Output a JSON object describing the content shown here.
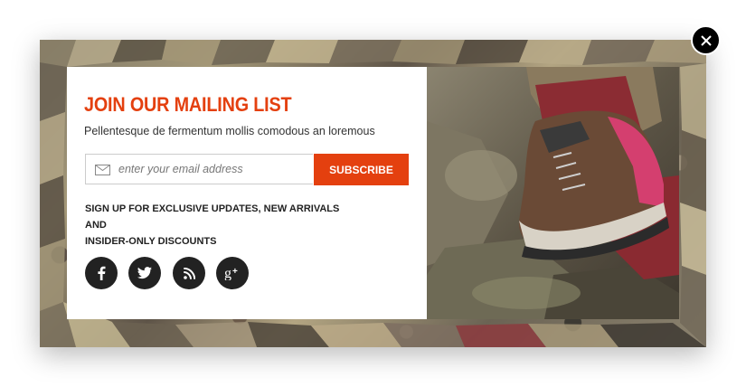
{
  "popup": {
    "title": "JOIN OUR MAILING LIST",
    "subtitle": "Pellentesque de fermentum mollis comodous an loremous",
    "email_placeholder": "enter your email address",
    "subscribe_label": "SUBSCRIBE",
    "note_line1": "SIGN UP FOR EXCLUSIVE UPDATES, NEW ARRIVALS AND",
    "note_line2": "INSIDER-ONLY DISCOUNTS",
    "close_icon": "close-icon",
    "accent_color": "#e4400f"
  },
  "social": [
    {
      "icon": "facebook-icon"
    },
    {
      "icon": "twitter-icon"
    },
    {
      "icon": "rss-icon"
    },
    {
      "icon": "google-plus-icon"
    }
  ]
}
